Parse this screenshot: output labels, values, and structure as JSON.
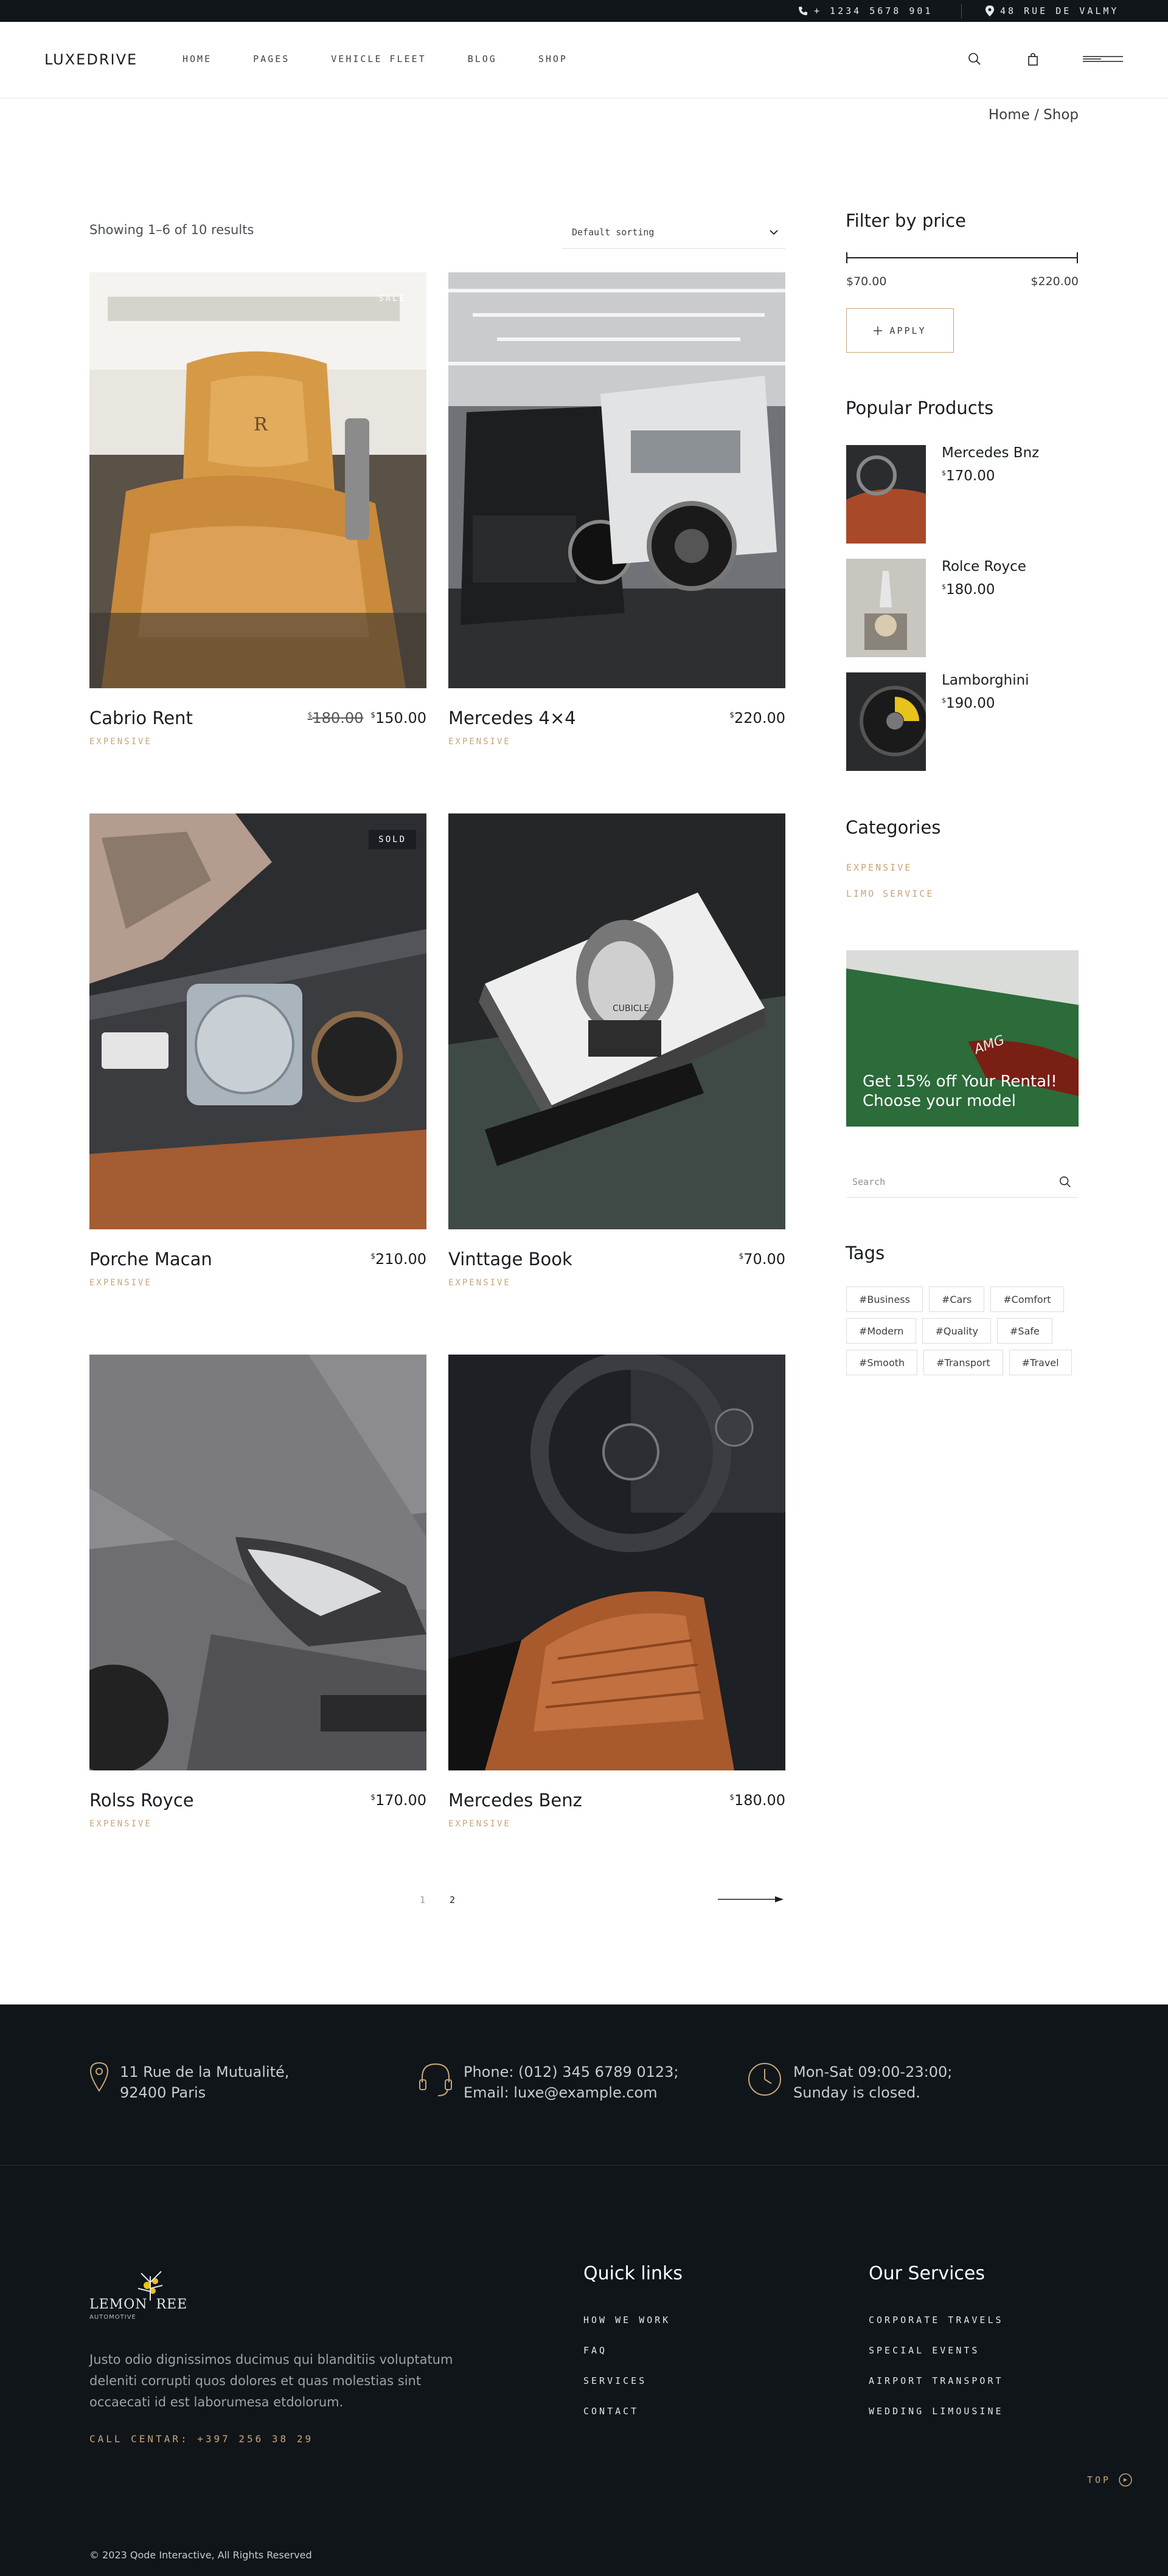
{
  "topbar": {
    "phone": "+ 1234 5678 901",
    "address": "48 RUE DE VALMY"
  },
  "header": {
    "logo": "LUXEDRIVE",
    "nav": [
      "HOME",
      "PAGES",
      "VEHICLE FLEET",
      "BLOG",
      "SHOP"
    ]
  },
  "breadcrumb": "Home / Shop",
  "shop": {
    "result_count": "Showing 1–6 of 10 results",
    "sorting": "Default sorting",
    "products": [
      {
        "name": "Cabrio Rent",
        "old_price": "180.00",
        "price": "150.00",
        "category": "EXPENSIVE",
        "badge": "SALE"
      },
      {
        "name": "Mercedes 4×4",
        "price": "220.00",
        "category": "EXPENSIVE"
      },
      {
        "name": "Porche Macan",
        "price": "210.00",
        "category": "EXPENSIVE",
        "badge": "SOLD"
      },
      {
        "name": "Vinttage Book",
        "price": "70.00",
        "category": "EXPENSIVE"
      },
      {
        "name": "Rolss Royce",
        "price": "170.00",
        "category": "EXPENSIVE"
      },
      {
        "name": "Mercedes Benz",
        "price": "180.00",
        "category": "EXPENSIVE"
      }
    ],
    "currency": "$",
    "pages": [
      "1",
      "2"
    ]
  },
  "sidebar": {
    "filter_title": "Filter by price",
    "price_min": "$70.00",
    "price_max": "$220.00",
    "apply": "APPLY",
    "popular_title": "Popular Products",
    "popular": [
      {
        "name": "Mercedes Bnz",
        "price": "170.00"
      },
      {
        "name": "Rolce Royce",
        "price": "180.00"
      },
      {
        "name": "Lamborghini",
        "price": "190.00"
      }
    ],
    "categories_title": "Categories",
    "categories": [
      "EXPENSIVE",
      "LIMO SERVICE"
    ],
    "promo_line1": "Get 15% off Your Rental!",
    "promo_line2": "Choose your model",
    "search_placeholder": "Search",
    "tags_title": "Tags",
    "tags": [
      "#Business",
      "#Cars",
      "#Comfort",
      "#Modern",
      "#Quality",
      "#Safe",
      "#Smooth",
      "#Transport",
      "#Travel"
    ]
  },
  "footer": {
    "address_line1": "11 Rue de la Mutualité,",
    "address_line2": "92400 Paris",
    "phone_line": "Phone: (012) 345 6789 0123;",
    "email_line": "Email: luxe@example.com",
    "hours_line1": "Mon-Sat 09:00-23:00;",
    "hours_line2": "Sunday is closed.",
    "logo_word1": "LEMON",
    "logo_word2": "REE",
    "logo_sub": "AUTOMOTIVE",
    "description": "Justo odio dignissimos ducimus qui blanditiis voluptatum deleniti corrupti quos dolores et quas molestias sint occaecati id est laborumesa etdolorum.",
    "call": "CALL CENTAR: +397 256 38 29",
    "quick_title": "Quick links",
    "quick_links": [
      "HOW WE WORK",
      "FAQ",
      "SERVICES",
      "CONTACT"
    ],
    "services_title": "Our Services",
    "services": [
      "CORPORATE TRAVELS",
      "SPECIAL EVENTS",
      "AIRPORT TRANSPORT",
      "WEDDING LIMOUSINE"
    ],
    "top": "TOP",
    "copyright": "© 2023 Qode Interactive, All Rights Reserved"
  },
  "colors": {
    "accent": "#c8a57a",
    "dark": "#10151a",
    "text": "#1a1d21"
  }
}
